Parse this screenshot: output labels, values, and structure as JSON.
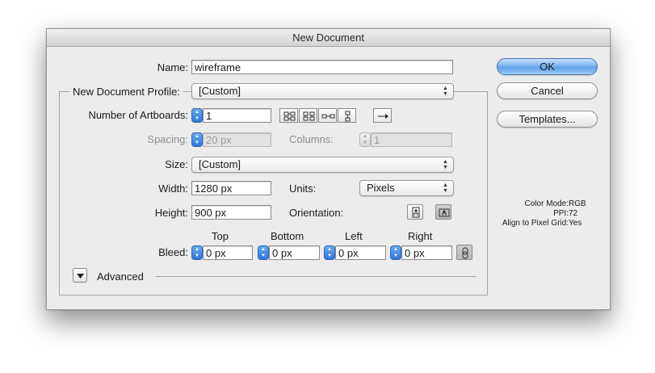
{
  "dialog": {
    "title": "New Document"
  },
  "name": {
    "label": "Name:",
    "value": "wireframe"
  },
  "profile": {
    "label": "New Document Profile:",
    "value": "[Custom]"
  },
  "artboards": {
    "label": "Number of Artboards:",
    "value": "1"
  },
  "spacing": {
    "label": "Spacing:",
    "value": "20 px"
  },
  "columns": {
    "label": "Columns:",
    "value": "1"
  },
  "size": {
    "label": "Size:",
    "value": "[Custom]"
  },
  "width": {
    "label": "Width:",
    "value": "1280 px"
  },
  "units": {
    "label": "Units:",
    "value": "Pixels"
  },
  "height": {
    "label": "Height:",
    "value": "900 px"
  },
  "orientation": {
    "label": "Orientation:",
    "selected": "landscape"
  },
  "bleed": {
    "label": "Bleed:",
    "top": {
      "label": "Top",
      "value": "0 px"
    },
    "bottom": {
      "label": "Bottom",
      "value": "0 px"
    },
    "left": {
      "label": "Left",
      "value": "0 px"
    },
    "right": {
      "label": "Right",
      "value": "0 px"
    }
  },
  "advanced": {
    "label": "Advanced"
  },
  "buttons": {
    "ok": "OK",
    "cancel": "Cancel",
    "templates": "Templates..."
  },
  "info": {
    "color_mode_label": "Color Mode:",
    "color_mode": "RGB",
    "ppi_label": "PPI:",
    "ppi": "72",
    "align_label": "Align to Pixel Grid:",
    "align": "Yes"
  },
  "icons": [
    "grid-by-row-icon",
    "grid-by-column-icon",
    "arrange-by-row-icon",
    "arrange-by-column-icon",
    "left-to-right-layout-icon",
    "portrait-icon",
    "landscape-icon",
    "link-icon",
    "disclosure-triangle-icon"
  ],
  "colors": {
    "default_button": "#5a9de6",
    "stepper": "#2b78de",
    "window": "#ececec"
  }
}
